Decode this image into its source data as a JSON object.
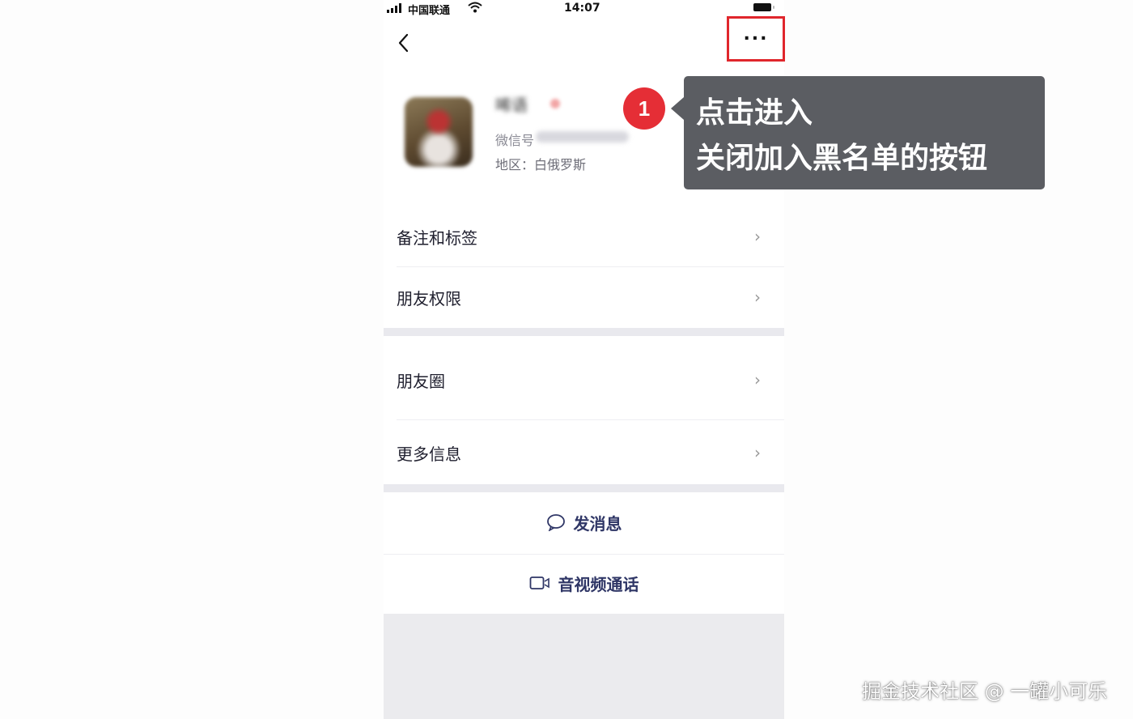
{
  "status_bar": {
    "carrier": "中国联通",
    "time": "14:07"
  },
  "nav": {
    "back_icon": "chevron-left-icon",
    "more_label": "..."
  },
  "profile": {
    "name": "唏语",
    "wechat_label": "微信号",
    "region": "地区：白俄罗斯"
  },
  "menu": {
    "items": [
      {
        "label": "备注和标签",
        "chevron": "›"
      },
      {
        "label": "朋友权限",
        "chevron": "›"
      },
      {
        "label": "朋友圈",
        "chevron": "›"
      },
      {
        "label": "更多信息",
        "chevron": "›"
      }
    ]
  },
  "actions": {
    "send_message": "发消息",
    "video_call": "音视频通话"
  },
  "annotation": {
    "step": "1",
    "line1": "点击进入",
    "line2": "关闭加入黑名单的按钮",
    "highlight_color": "#e0262c",
    "badge_color": "#e52e36"
  },
  "watermark": "掘金技术社区 @ 一罐小可乐"
}
